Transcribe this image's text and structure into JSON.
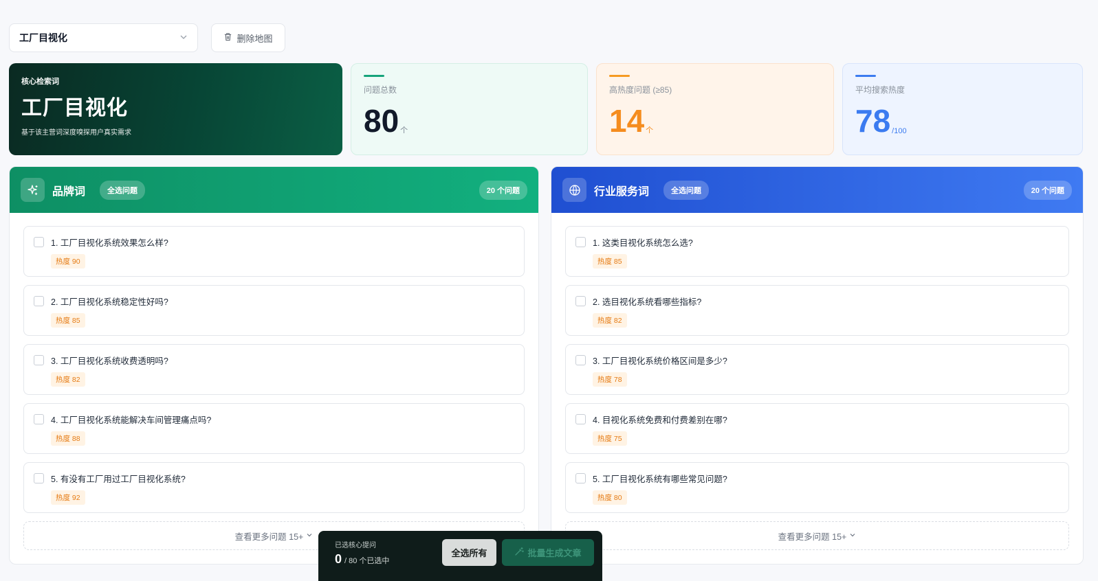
{
  "toolbar": {
    "select_value": "工厂目视化",
    "delete_label": "删除地图"
  },
  "hero": {
    "eyebrow": "核心检索词",
    "title": "工厂目视化",
    "subtitle": "基于该主营词深度嗅探用户真实需求"
  },
  "stats": [
    {
      "label": "问题总数",
      "value": "80",
      "unit": "个",
      "accent": "#16a37a"
    },
    {
      "label": "高热度问题 (≥85)",
      "value": "14",
      "unit": "个",
      "accent": "#f59a22"
    },
    {
      "label": "平均搜索热度",
      "value": "78",
      "unit": "/100",
      "accent": "#3b7bf0"
    }
  ],
  "panels": [
    {
      "title": "品牌词",
      "select_label": "全选问题",
      "count_label": "20 个问题",
      "icon": "sparkle-icon",
      "color": "#12b07f",
      "questions": [
        {
          "text": "1. 工厂目视化系统效果怎么样?",
          "heat": "热度 90"
        },
        {
          "text": "2. 工厂目视化系统稳定性好吗?",
          "heat": "热度 85"
        },
        {
          "text": "3. 工厂目视化系统收费透明吗?",
          "heat": "热度 82"
        },
        {
          "text": "4. 工厂目视化系统能解决车间管理痛点吗?",
          "heat": "热度 88"
        },
        {
          "text": "5. 有没有工厂用过工厂目视化系统?",
          "heat": "热度 92"
        }
      ],
      "more_label": "查看更多问题 15+"
    },
    {
      "title": "行业服务词",
      "select_label": "全选问题",
      "count_label": "20 个问题",
      "icon": "globe-icon",
      "color": "#3f7af2",
      "questions": [
        {
          "text": "1. 这类目视化系统怎么选?",
          "heat": "热度 85"
        },
        {
          "text": "2. 选目视化系统看哪些指标?",
          "heat": "热度 82"
        },
        {
          "text": "3. 工厂目视化系统价格区间是多少?",
          "heat": "热度 78"
        },
        {
          "text": "4. 目视化系统免费和付费差别在哪?",
          "heat": "热度 75"
        },
        {
          "text": "5. 工厂目视化系统有哪些常见问题?",
          "heat": "热度 80"
        }
      ],
      "more_label": "查看更多问题 15+"
    }
  ],
  "footer_bar": {
    "label": "已选核心提问",
    "selected": "0",
    "total_text": "/ 80 个已选中",
    "select_all": "全选所有",
    "generate": "批量生成文章"
  }
}
